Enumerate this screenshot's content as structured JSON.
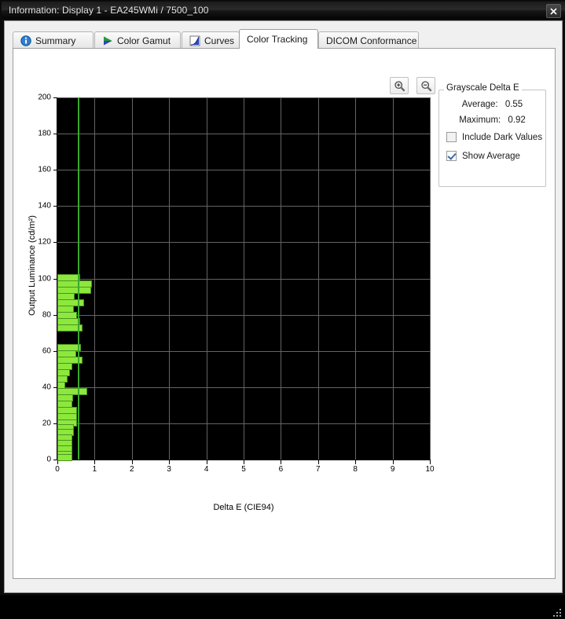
{
  "window": {
    "title": "Information: Display 1 - EA245WMi / 7500_100",
    "close_label": "Close",
    "close_icon": "close-icon"
  },
  "tabs": [
    {
      "label": "Summary",
      "icon": "info-icon",
      "active": false
    },
    {
      "label": "Color Gamut",
      "icon": "gamut-triangle-icon",
      "active": false
    },
    {
      "label": "Curves",
      "icon": "curve-graph-icon",
      "active": false
    },
    {
      "label": "Color Tracking",
      "icon": "",
      "active": true
    },
    {
      "label": "DICOM Conformance",
      "icon": "",
      "active": false
    }
  ],
  "toolbar": {
    "zoom_in_label": "Zoom In",
    "zoom_in_icon": "zoom-in-icon",
    "zoom_out_label": "Zoom Out",
    "zoom_out_icon": "zoom-out-icon"
  },
  "sidebar": {
    "group_title": "Grayscale Delta E",
    "average_label": "Average:",
    "average_value": "0.55",
    "maximum_label": "Maximum:",
    "maximum_value": "0.92",
    "include_dark_values_label": "Include Dark Values",
    "include_dark_values_checked": false,
    "show_average_label": "Show Average",
    "show_average_checked": true
  },
  "colors": {
    "bar_fill": "#8ce83c",
    "bar_stroke": "#4e9422",
    "average_line": "#3ba82a",
    "plot_background": "#000000",
    "gridline": "#646464"
  },
  "chart_data": {
    "type": "bar",
    "orientation": "horizontal",
    "title": "",
    "xlabel": "Delta E (CIE94)",
    "ylabel": "Output Luminance (cd/m²)",
    "xlim": [
      0,
      10
    ],
    "ylim": [
      0,
      200
    ],
    "xticks": [
      0,
      1,
      2,
      3,
      4,
      5,
      6,
      7,
      8,
      9,
      10
    ],
    "yticks": [
      0,
      20,
      40,
      60,
      80,
      100,
      120,
      140,
      160,
      180,
      200
    ],
    "grid": true,
    "legend": null,
    "average_line_value": 0.55,
    "maximum_value": 0.92,
    "y_values": [
      100.5,
      97.0,
      93.5,
      90.0,
      86.5,
      83.0,
      79.5,
      76.0,
      72.5,
      62.0,
      58.5,
      55.0,
      51.5,
      48.0,
      44.5,
      41.0,
      37.5,
      34.0,
      30.5,
      27.0,
      23.5,
      20.0,
      17.5,
      15.0,
      12.0,
      9.0,
      6.0,
      3.0,
      1.0
    ],
    "values": [
      0.62,
      0.92,
      0.9,
      0.46,
      0.72,
      0.45,
      0.52,
      0.62,
      0.68,
      0.64,
      0.5,
      0.68,
      0.4,
      0.33,
      0.27,
      0.21,
      0.8,
      0.42,
      0.4,
      0.53,
      0.53,
      0.53,
      0.45,
      0.45,
      0.4,
      0.4,
      0.4,
      0.4,
      0.4
    ]
  }
}
